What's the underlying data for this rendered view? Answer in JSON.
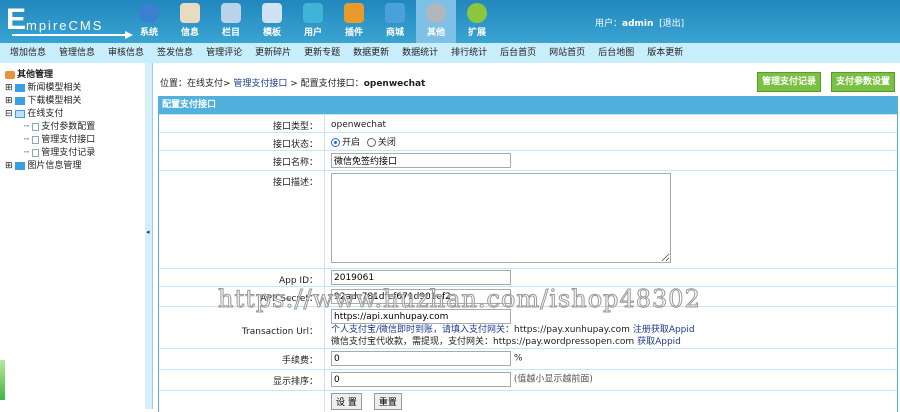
{
  "logo": {
    "first": "E",
    "rest": "mpireCMS"
  },
  "topnav": [
    {
      "label": "系统",
      "icon": "globe-icon",
      "color": "#3a7fd0"
    },
    {
      "label": "信息",
      "icon": "edit-icon",
      "color": "#e8dcc0"
    },
    {
      "label": "栏目",
      "icon": "folder-icon",
      "color": "#b9d3e8"
    },
    {
      "label": "模板",
      "icon": "window-icon",
      "color": "#cfe3f2"
    },
    {
      "label": "用户",
      "icon": "user-icon",
      "color": "#3fb4d8"
    },
    {
      "label": "插件",
      "icon": "tools-icon",
      "color": "#e89b2a"
    },
    {
      "label": "商城",
      "icon": "card-icon",
      "color": "#4aa0d8"
    },
    {
      "label": "其他",
      "icon": "gear-icon",
      "color": "#b0b6bc"
    },
    {
      "label": "扩展",
      "icon": "plus-icon",
      "color": "#8cc63f"
    }
  ],
  "active_top": "其他",
  "user": {
    "prefix": "用户：",
    "name": "admin",
    "logout": "[退出]"
  },
  "subnav": [
    "增加信息",
    "管理信息",
    "审核信息",
    "签发信息",
    "管理评论",
    "更新碎片",
    "更新专题",
    "数据更新",
    "数据统计",
    "排行统计",
    "后台首页",
    "网站首页",
    "后台地图",
    "版本更新"
  ],
  "sidebar": {
    "title": "其他管理",
    "items": [
      "新闻模型相关",
      "下载模型相关",
      "在线支付"
    ],
    "children": [
      "支付参数配置",
      "管理支付接口",
      "管理支付记录"
    ],
    "last": "图片信息管理"
  },
  "splitter_arrow": "◂",
  "breadcrumb": {
    "prefix": "位置：在线支付> ",
    "link": "管理支付接口",
    "mid": " > 配置支付接口：",
    "current": "openwechat"
  },
  "buttons": {
    "records": "管理支付记录",
    "settings": "支付参数设置"
  },
  "form": {
    "title": "配置支付接口",
    "type_label": "接口类型：",
    "type_value": "openwechat",
    "status_label": "接口状态：",
    "status_on": "开启",
    "status_off": "关闭",
    "name_label": "接口名称：",
    "name_value": "微信免签约接口",
    "desc_label": "接口描述：",
    "desc_value": "",
    "appid_label": "App ID：",
    "appid_value": "2019061",
    "secret_label": "APP Secret：",
    "secret_value": "92adc781dfef671d901ef2",
    "url_label": "Transaction Url：",
    "url_value": "https://api.xunhupay.com",
    "url_note1": "个人支付宝/微信即时到账，请填入支付网关：",
    "url_note1_gw": "https://pay.xunhupay.com",
    "url_note1_link": "注册获取Appid",
    "url_note2": "微信支付宝代收款，需提现，支付网关：",
    "url_note2_gw": "https://pay.wordpressopen.com",
    "url_note2_link": "获取Appid",
    "fee_label": "手续费：",
    "fee_value": "0",
    "fee_unit": "%",
    "sort_label": "显示排序：",
    "sort_value": "0",
    "sort_note": "(值越小显示越前面)",
    "submit": "设 置",
    "reset": "重置"
  },
  "watermark": "https://www.huzhan.com/ishop48302"
}
